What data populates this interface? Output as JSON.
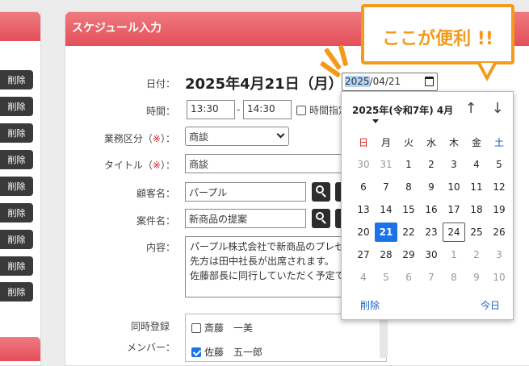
{
  "left_panel": {
    "delete_label": "削除"
  },
  "form": {
    "title": "スケジュール入力",
    "date_label": "日付：",
    "date_display": "2025年4月21日（月）",
    "date_input_year": "2025",
    "date_input_rest": "/04/21",
    "time_label": "時間：",
    "time_start": "13:30",
    "time_sep": "-",
    "time_end": "14:30",
    "time_unspecified_label": "時間指定",
    "category_label": "業務区分（",
    "category_req": "※",
    "category_label_end": "）：",
    "category_value": "商談",
    "title_label": "タイトル（",
    "title_req": "※",
    "title_label_end": "）：",
    "title_value": "商談",
    "customer_label": "顧客名：",
    "customer_value": "パープル",
    "project_label": "案件名：",
    "project_value": "新商品の提案",
    "content_label": "内容：",
    "content_lines": [
      "パープル株式会社で新商品のプレゼ",
      "先方は田中社長が出席されます。",
      "佐藤部長に同行していただく予定で"
    ],
    "members_label_1": "同時登録",
    "members_label_2": "メンバー：",
    "members": [
      {
        "name": "斎藤　一美",
        "checked": false
      },
      {
        "name": "佐藤　五一郎",
        "checked": true
      }
    ]
  },
  "callout": {
    "text": "ここが便利 !!",
    "color": "#f39a1d"
  },
  "calendar": {
    "month_label": "2025年(令和7年) 4月",
    "weekdays": [
      "日",
      "月",
      "火",
      "水",
      "木",
      "金",
      "土"
    ],
    "weeks": [
      [
        "30",
        "31",
        "1",
        "2",
        "3",
        "4",
        "5"
      ],
      [
        "6",
        "7",
        "8",
        "9",
        "10",
        "11",
        "12"
      ],
      [
        "13",
        "14",
        "15",
        "16",
        "17",
        "18",
        "19"
      ],
      [
        "20",
        "21",
        "22",
        "23",
        "24",
        "25",
        "26"
      ],
      [
        "27",
        "28",
        "29",
        "30",
        "1",
        "2",
        "3"
      ],
      [
        "4",
        "5",
        "6",
        "7",
        "8",
        "9",
        "10"
      ]
    ],
    "selected_day": "21",
    "today_day": "24",
    "clear_label": "削除",
    "today_label": "今日",
    "accent": "#1a73e8"
  },
  "colors": {
    "header_red": "#e34f59",
    "accent_orange": "#f39a1d"
  }
}
